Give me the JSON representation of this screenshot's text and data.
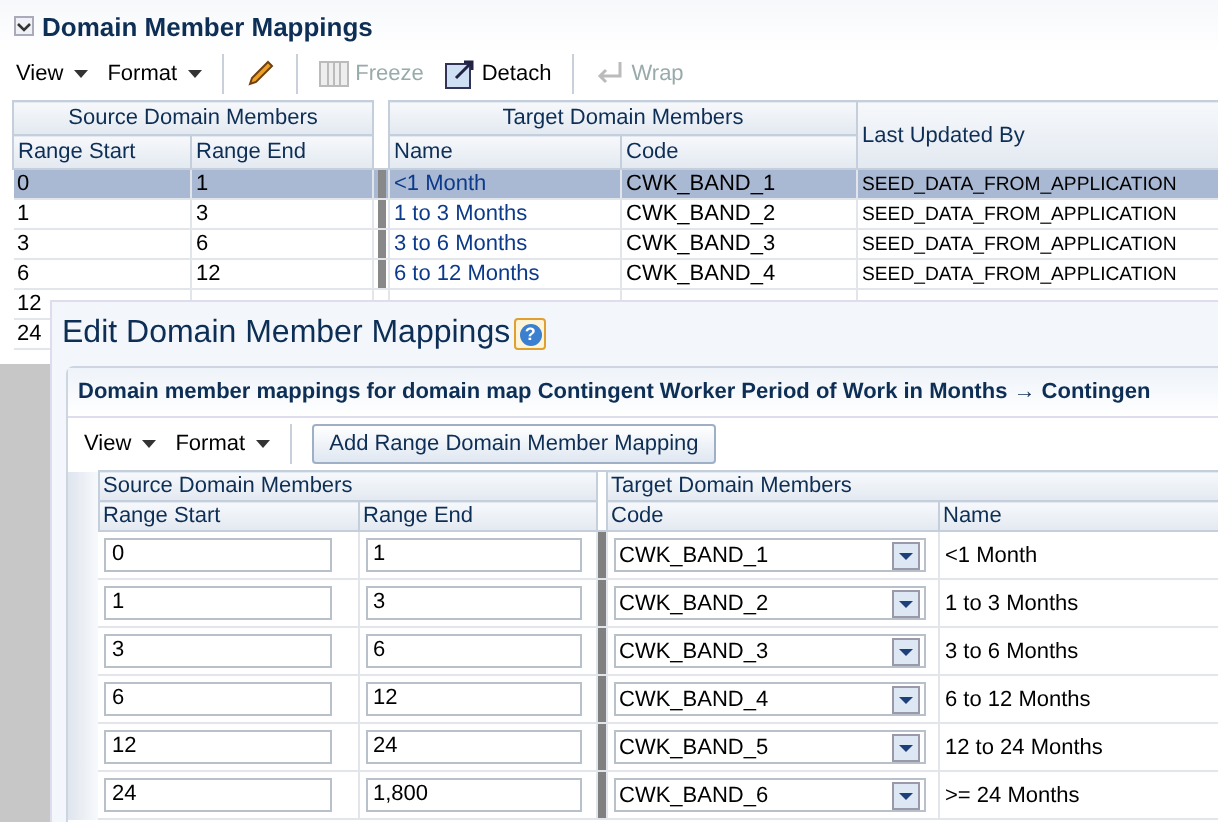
{
  "section": {
    "title": "Domain Member Mappings",
    "expanded": true
  },
  "toolbar": {
    "menus": [
      "View",
      "Format"
    ],
    "buttons": [
      {
        "kind": "edit",
        "disabled": false
      },
      {
        "kind": "freeze",
        "label": "Freeze",
        "disabled": true
      },
      {
        "kind": "detach",
        "label": "Detach",
        "disabled": false
      },
      {
        "kind": "wrap",
        "label": "Wrap",
        "disabled": true
      }
    ]
  },
  "table": {
    "groups": [
      "Source Domain Members",
      "Target Domain Members"
    ],
    "columns": [
      "Range Start",
      "Range End",
      "Name",
      "Code",
      "Last Updated By"
    ],
    "rows": [
      {
        "range_start": "0",
        "range_end": "1",
        "name": "<1 Month",
        "code": "CWK_BAND_1",
        "last_updated_by": "SEED_DATA_FROM_APPLICATION",
        "selected": true
      },
      {
        "range_start": "1",
        "range_end": "3",
        "name": "1 to 3 Months",
        "code": "CWK_BAND_2",
        "last_updated_by": "SEED_DATA_FROM_APPLICATION",
        "selected": false
      },
      {
        "range_start": "3",
        "range_end": "6",
        "name": "3 to 6 Months",
        "code": "CWK_BAND_3",
        "last_updated_by": "SEED_DATA_FROM_APPLICATION",
        "selected": false
      },
      {
        "range_start": "6",
        "range_end": "12",
        "name": "6 to 12 Months",
        "code": "CWK_BAND_4",
        "last_updated_by": "SEED_DATA_FROM_APPLICATION",
        "selected": false
      },
      {
        "range_start": "12",
        "selected": false
      },
      {
        "range_start": "24",
        "selected": false
      }
    ]
  },
  "dialog": {
    "title": "Edit Domain Member Mappings",
    "help": "?",
    "panel_title": "Domain member mappings for domain map Contingent Worker Period of Work in Months → Contingen",
    "menus": [
      "View",
      "Format"
    ],
    "add_button": "Add Range Domain Member Mapping",
    "groups": [
      "Source Domain Members",
      "Target Domain Members"
    ],
    "columns": [
      "Range Start",
      "Range End",
      "Code",
      "Name"
    ],
    "rows": [
      {
        "range_start": "0",
        "range_end": "1",
        "code": "CWK_BAND_1",
        "name": "<1 Month"
      },
      {
        "range_start": "1",
        "range_end": "3",
        "code": "CWK_BAND_2",
        "name": "1 to 3 Months"
      },
      {
        "range_start": "3",
        "range_end": "6",
        "code": "CWK_BAND_3",
        "name": "3 to 6 Months"
      },
      {
        "range_start": "6",
        "range_end": "12",
        "code": "CWK_BAND_4",
        "name": "6 to 12 Months"
      },
      {
        "range_start": "12",
        "range_end": "24",
        "code": "CWK_BAND_5",
        "name": "12 to 24 Months"
      },
      {
        "range_start": "24",
        "range_end": "1,800",
        "code": "CWK_BAND_6",
        "name": ">= 24 Months"
      }
    ]
  }
}
